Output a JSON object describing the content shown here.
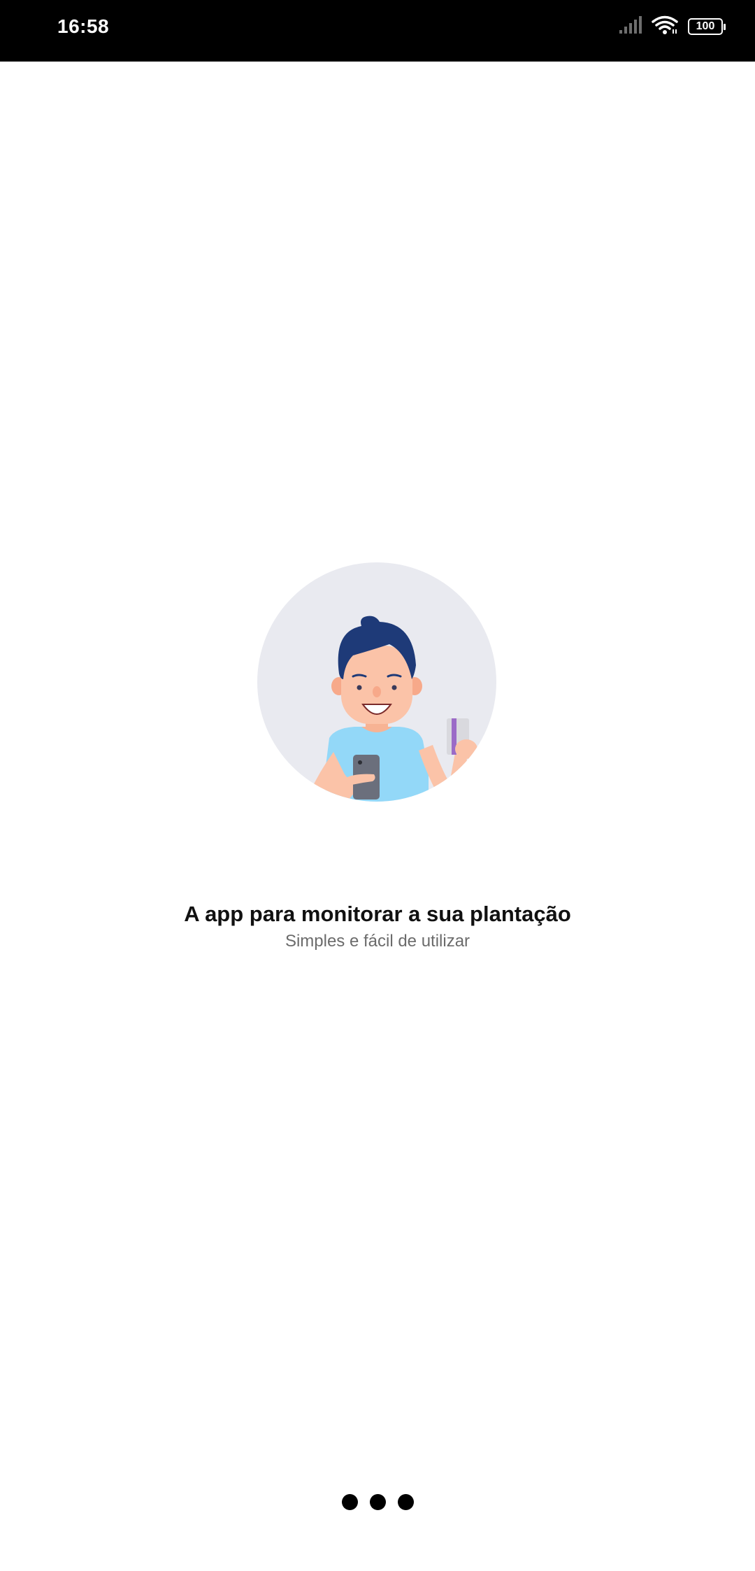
{
  "status_bar": {
    "time": "16:58",
    "battery_level": "100",
    "icons": [
      "signal-icon",
      "wifi-icon",
      "battery-icon"
    ]
  },
  "onboarding": {
    "illustration": "person-with-phone-and-card-illustration",
    "title": "A app para monitorar a sua plantação",
    "subtitle": "Simples e fácil de utilizar"
  },
  "loading_indicator": {
    "dots": 3,
    "color": "#000000"
  },
  "colors": {
    "background": "#ffffff",
    "status_bar": "#000000",
    "illustration_circle": "#e9eaf0",
    "hair": "#1e3a78",
    "shirt": "#93d8f8",
    "skin": "#fbc3a8"
  }
}
